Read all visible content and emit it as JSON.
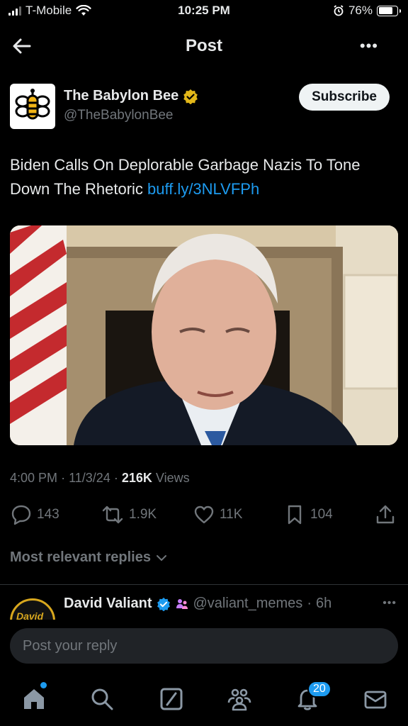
{
  "status_bar": {
    "carrier": "T-Mobile",
    "time": "10:25 PM",
    "battery": "76%",
    "battery_level": 0.76
  },
  "header": {
    "title": "Post",
    "back_icon": "arrow-left-icon",
    "more_icon": "more-horizontal-icon",
    "more_label": "•••"
  },
  "author": {
    "name": "The Babylon Bee",
    "handle": "@TheBabylonBee",
    "verified_color": "#e2b719",
    "subscribe_label": "Subscribe"
  },
  "post": {
    "text": "Biden Calls On Deplorable Garbage Nazis To Tone Down The Rhetoric ",
    "link": "buff.ly/3NLVFPh",
    "time": "4:00 PM",
    "date": "11/3/24",
    "views_count": "216K",
    "views_label": "Views",
    "sep": "·"
  },
  "actions": {
    "replies": "143",
    "reposts": "1.9K",
    "likes": "11K",
    "bookmarks": "104"
  },
  "replies_section": {
    "label": "Most relevant replies"
  },
  "reply_preview": {
    "avatar_text": "David",
    "name": "David Valiant",
    "handle": "@valiant_memes",
    "age": "6h",
    "sep": "·",
    "more_label": "•••"
  },
  "reply_box": {
    "placeholder": "Post your reply"
  },
  "tabbar": {
    "notifications_badge": "20"
  },
  "colors": {
    "accent": "#1d9bf0",
    "background": "#000000",
    "muted": "#71767b",
    "text": "#e7e9ea"
  }
}
